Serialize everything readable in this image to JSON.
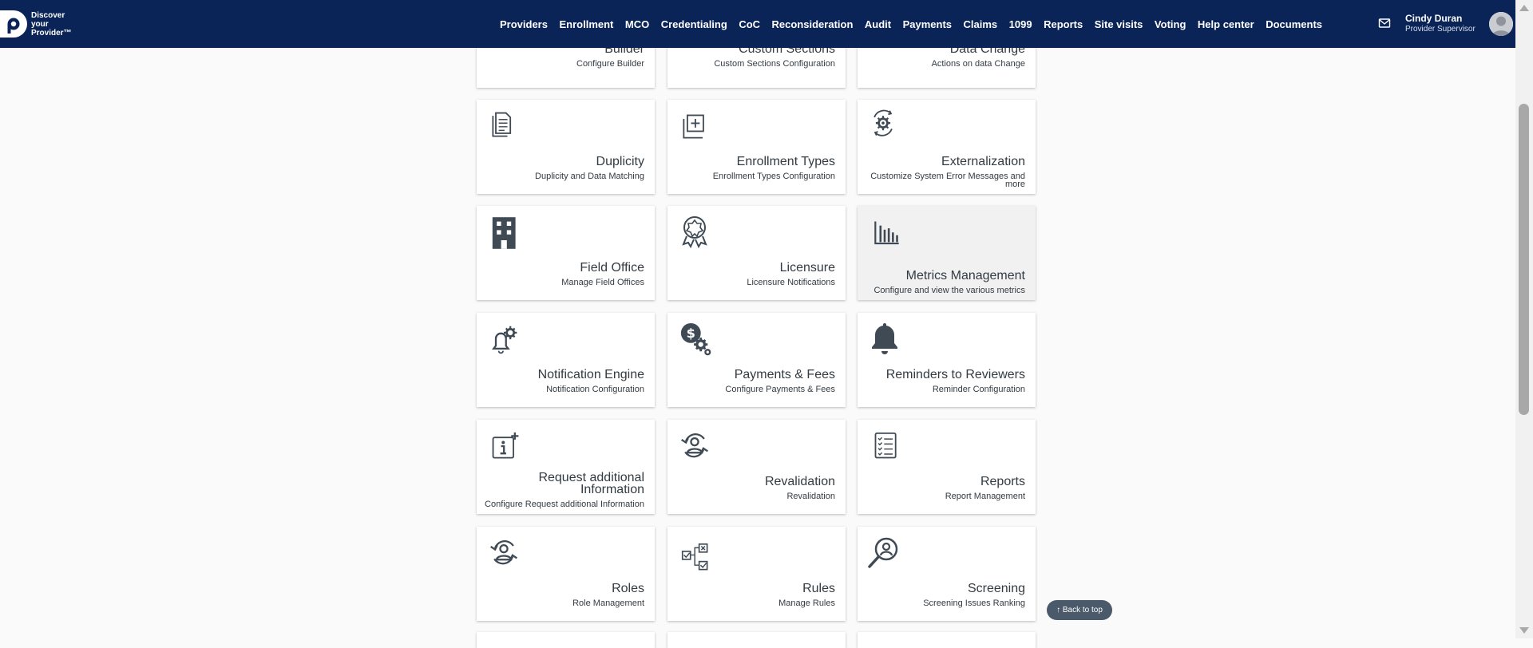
{
  "brand": {
    "logo_text": "Discover\nyour\nProvider™"
  },
  "nav": [
    "Providers",
    "Enrollment",
    "MCO",
    "Credentialing",
    "CoC",
    "Reconsideration",
    "Audit",
    "Payments",
    "Claims",
    "1099",
    "Reports",
    "Site visits",
    "Voting",
    "Help center",
    "Documents"
  ],
  "user": {
    "name": "Cindy Duran",
    "role": "Provider Supervisor"
  },
  "cards": [
    {
      "icon": "builder-icon",
      "title": "Builder",
      "subtitle": "Configure Builder"
    },
    {
      "icon": "custom-sections-icon",
      "title": "Custom Sections",
      "subtitle": "Custom Sections Configuration"
    },
    {
      "icon": "data-change-icon",
      "title": "Data Change",
      "subtitle": "Actions on data Change"
    },
    {
      "icon": "documents-icon",
      "title": "Duplicity",
      "subtitle": "Duplicity and Data Matching"
    },
    {
      "icon": "add-box-icon",
      "title": "Enrollment Types",
      "subtitle": "Enrollment Types Configuration"
    },
    {
      "icon": "gear-cycle-icon",
      "title": "Externalization",
      "subtitle": "Customize System Error Messages and more"
    },
    {
      "icon": "building-icon",
      "title": "Field Office",
      "subtitle": "Manage Field Offices"
    },
    {
      "icon": "badge-icon",
      "title": "Licensure",
      "subtitle": "Licensure Notifications"
    },
    {
      "icon": "bar-chart-icon",
      "title": "Metrics Management",
      "subtitle": "Configure and view the various metrics"
    },
    {
      "icon": "bell-gear-icon",
      "title": "Notification Engine",
      "subtitle": "Notification Configuration"
    },
    {
      "icon": "dollar-gears-icon",
      "title": "Payments & Fees",
      "subtitle": "Configure Payments & Fees"
    },
    {
      "icon": "bell-icon",
      "title": "Reminders to Reviewers",
      "subtitle": "Reminder Configuration"
    },
    {
      "icon": "info-plus-icon",
      "title": "Request additional Information",
      "subtitle": "Configure Request additional Information"
    },
    {
      "icon": "user-cycle-icon",
      "title": "Revalidation",
      "subtitle": "Revalidation"
    },
    {
      "icon": "checklist-icon",
      "title": "Reports",
      "subtitle": "Report Management"
    },
    {
      "icon": "user-cycle-icon",
      "title": "Roles",
      "subtitle": "Role Management"
    },
    {
      "icon": "rules-icon",
      "title": "Rules",
      "subtitle": "Manage Rules"
    },
    {
      "icon": "search-user-icon",
      "title": "Screening",
      "subtitle": "Screening Issues Ranking"
    }
  ],
  "back_to_top": "↑ Back to top",
  "colors": {
    "navbar": "#0a2457",
    "text": "#333b42",
    "card_bg": "#ffffff",
    "card_hover": "#f1f1f2"
  }
}
